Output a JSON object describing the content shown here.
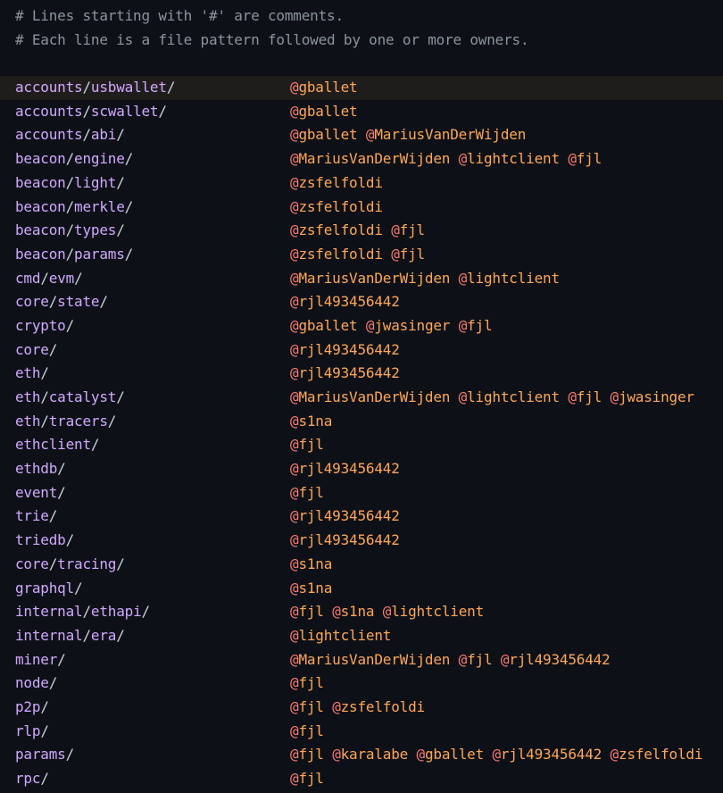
{
  "comments": [
    "# Lines starting with '#' are comments.",
    "# Each line is a file pattern followed by one or more owners."
  ],
  "entries": [
    {
      "path": "accounts/usbwallet/",
      "owners": [
        "gballet"
      ]
    },
    {
      "path": "accounts/scwallet/",
      "owners": [
        "gballet"
      ]
    },
    {
      "path": "accounts/abi/",
      "owners": [
        "gballet",
        "MariusVanDerWijden"
      ]
    },
    {
      "path": "beacon/engine/",
      "owners": [
        "MariusVanDerWijden",
        "lightclient",
        "fjl"
      ]
    },
    {
      "path": "beacon/light/",
      "owners": [
        "zsfelfoldi"
      ]
    },
    {
      "path": "beacon/merkle/",
      "owners": [
        "zsfelfoldi"
      ]
    },
    {
      "path": "beacon/types/",
      "owners": [
        "zsfelfoldi",
        "fjl"
      ]
    },
    {
      "path": "beacon/params/",
      "owners": [
        "zsfelfoldi",
        "fjl"
      ]
    },
    {
      "path": "cmd/evm/",
      "owners": [
        "MariusVanDerWijden",
        "lightclient"
      ]
    },
    {
      "path": "core/state/",
      "owners": [
        "rjl493456442"
      ]
    },
    {
      "path": "crypto/",
      "owners": [
        "gballet",
        "jwasinger",
        "fjl"
      ]
    },
    {
      "path": "core/",
      "owners": [
        "rjl493456442"
      ]
    },
    {
      "path": "eth/",
      "owners": [
        "rjl493456442"
      ]
    },
    {
      "path": "eth/catalyst/",
      "owners": [
        "MariusVanDerWijden",
        "lightclient",
        "fjl",
        "jwasinger"
      ]
    },
    {
      "path": "eth/tracers/",
      "owners": [
        "s1na"
      ]
    },
    {
      "path": "ethclient/",
      "owners": [
        "fjl"
      ]
    },
    {
      "path": "ethdb/",
      "owners": [
        "rjl493456442"
      ]
    },
    {
      "path": "event/",
      "owners": [
        "fjl"
      ]
    },
    {
      "path": "trie/",
      "owners": [
        "rjl493456442"
      ]
    },
    {
      "path": "triedb/",
      "owners": [
        "rjl493456442"
      ]
    },
    {
      "path": "core/tracing/",
      "owners": [
        "s1na"
      ]
    },
    {
      "path": "graphql/",
      "owners": [
        "s1na"
      ]
    },
    {
      "path": "internal/ethapi/",
      "owners": [
        "fjl",
        "s1na",
        "lightclient"
      ]
    },
    {
      "path": "internal/era/",
      "owners": [
        "lightclient"
      ]
    },
    {
      "path": "miner/",
      "owners": [
        "MariusVanDerWijden",
        "fjl",
        "rjl493456442"
      ]
    },
    {
      "path": "node/",
      "owners": [
        "fjl"
      ]
    },
    {
      "path": "p2p/",
      "owners": [
        "fjl",
        "zsfelfoldi"
      ]
    },
    {
      "path": "rlp/",
      "owners": [
        "fjl"
      ]
    },
    {
      "path": "params/",
      "owners": [
        "fjl",
        "karalabe",
        "gballet",
        "rjl493456442",
        "zsfelfoldi"
      ]
    },
    {
      "path": "rpc/",
      "owners": [
        "fjl"
      ]
    }
  ],
  "active_entry": 0,
  "colors": {
    "background": "#0d1117",
    "comment": "#8b949e",
    "path": "#d2a8ff",
    "owner": "#ffa657",
    "at_sign": "#ff7b72",
    "active_line": "#1f1d1c"
  }
}
